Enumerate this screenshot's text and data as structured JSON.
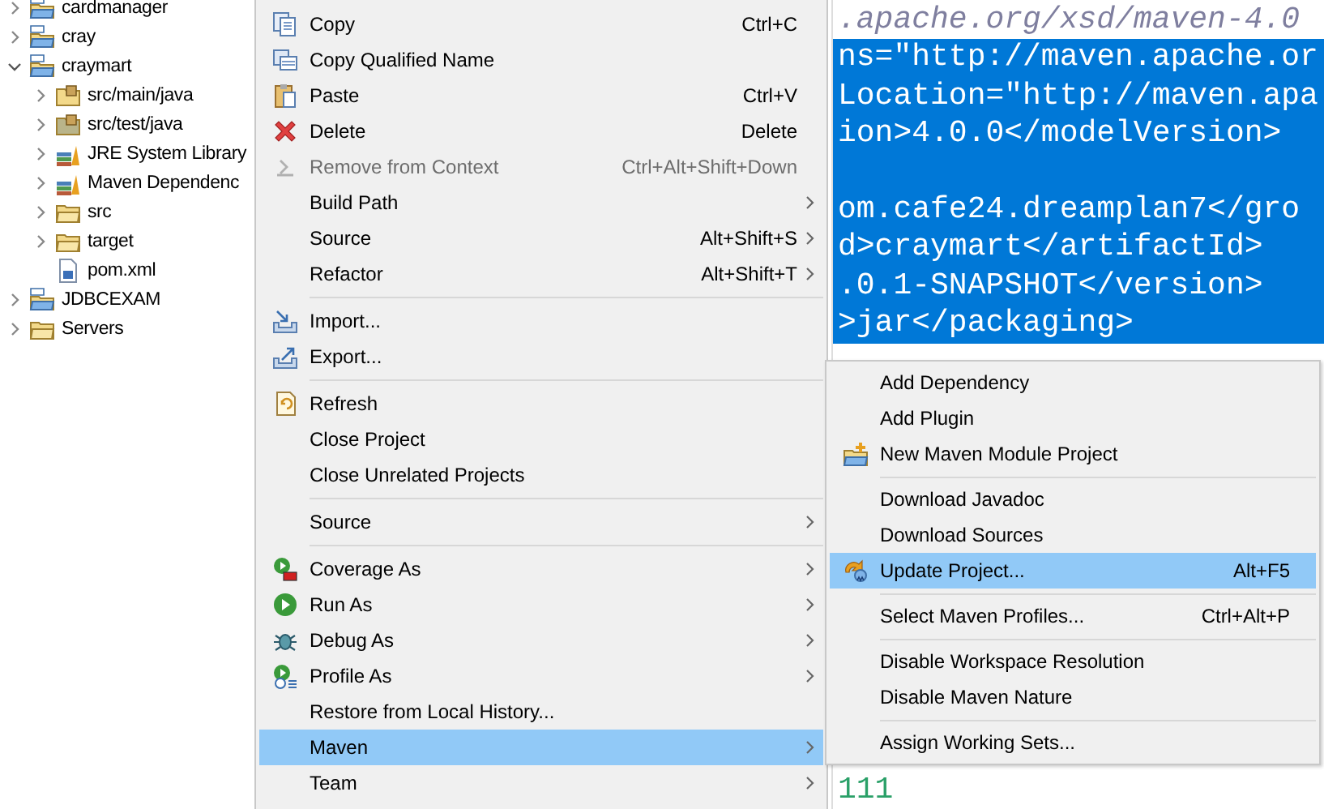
{
  "project_explorer": {
    "items": [
      {
        "label": "cardmanager",
        "kind": "project",
        "expanded": false
      },
      {
        "label": "cray",
        "kind": "project",
        "expanded": false
      },
      {
        "label": "craymart",
        "kind": "project",
        "expanded": true,
        "children": [
          {
            "label": "src/main/java",
            "kind": "source-folder",
            "expanded": false
          },
          {
            "label": "src/test/java",
            "kind": "test-folder",
            "expanded": false
          },
          {
            "label": "JRE System Library",
            "kind": "library",
            "expanded": false
          },
          {
            "label": "Maven Dependenc",
            "kind": "library",
            "expanded": false
          },
          {
            "label": "src",
            "kind": "folder",
            "expanded": false
          },
          {
            "label": "target",
            "kind": "folder",
            "expanded": false
          },
          {
            "label": "pom.xml",
            "kind": "file"
          }
        ]
      },
      {
        "label": "JDBCEXAM",
        "kind": "project",
        "expanded": false
      },
      {
        "label": "Servers",
        "kind": "folder",
        "expanded": false
      }
    ]
  },
  "editor": {
    "lines": [
      {
        "text": ".apache.org/xsd/maven-4.0",
        "kind": "comment",
        "selected": false
      },
      {
        "text": "ns=\"http://maven.apache.or",
        "kind": "code",
        "selected": true
      },
      {
        "text": "Location=\"http://maven.apa",
        "kind": "code",
        "selected": true
      },
      {
        "text": "ion>4.0.0</modelVersion>",
        "kind": "code",
        "selected": true
      },
      {
        "kind": "code",
        "selected": true
      },
      {
        "text": "om.cafe24.dreamplan7</gro",
        "kind": "code",
        "selected": true
      },
      {
        "text": "d>craymart</artifactId>",
        "kind": "code",
        "selected": true
      },
      {
        "text": ".0.1-SNAPSHOT</version>",
        "kind": "code",
        "selected": true
      },
      {
        "text": ">jar</packaging>",
        "kind": "code",
        "selected": true
      }
    ],
    "bottom_line": {
      "text": "111",
      "kind": "number",
      "selected": false
    }
  },
  "context_menu": {
    "items": [
      {
        "kind": "item",
        "label": "Copy",
        "shortcut": "Ctrl+C",
        "submenu": false,
        "disabled": false,
        "selected": false
      },
      {
        "kind": "item",
        "label": "Copy Qualified Name",
        "submenu": false,
        "disabled": false,
        "selected": false
      },
      {
        "kind": "item",
        "label": "Paste",
        "shortcut": "Ctrl+V",
        "submenu": false,
        "disabled": false,
        "selected": false
      },
      {
        "kind": "item",
        "label": "Delete",
        "shortcut": "Delete",
        "submenu": false,
        "disabled": false,
        "selected": false
      },
      {
        "kind": "item",
        "label": "Remove from Context",
        "shortcut": "Ctrl+Alt+Shift+Down",
        "submenu": false,
        "disabled": true,
        "selected": false
      },
      {
        "kind": "item",
        "label": "Build Path",
        "submenu": true,
        "disabled": false,
        "selected": false
      },
      {
        "kind": "item",
        "label": "Source",
        "shortcut": "Alt+Shift+S",
        "submenu": true,
        "disabled": false,
        "selected": false
      },
      {
        "kind": "item",
        "label": "Refactor",
        "shortcut": "Alt+Shift+T",
        "submenu": true,
        "disabled": false,
        "selected": false
      },
      {
        "kind": "separator"
      },
      {
        "kind": "item",
        "label": "Import...",
        "submenu": false,
        "disabled": false,
        "selected": false
      },
      {
        "kind": "item",
        "label": "Export...",
        "submenu": false,
        "disabled": false,
        "selected": false
      },
      {
        "kind": "separator"
      },
      {
        "kind": "item",
        "label": "Refresh",
        "submenu": false,
        "disabled": false,
        "selected": false
      },
      {
        "kind": "item",
        "label": "Close Project",
        "submenu": false,
        "disabled": false,
        "selected": false
      },
      {
        "kind": "item",
        "label": "Close Unrelated Projects",
        "submenu": false,
        "disabled": false,
        "selected": false
      },
      {
        "kind": "separator"
      },
      {
        "kind": "item",
        "label": "Source",
        "submenu": true,
        "disabled": false,
        "selected": false
      },
      {
        "kind": "separator"
      },
      {
        "kind": "item",
        "label": "Coverage As",
        "submenu": true,
        "disabled": false,
        "selected": false
      },
      {
        "kind": "item",
        "label": "Run As",
        "submenu": true,
        "disabled": false,
        "selected": false
      },
      {
        "kind": "item",
        "label": "Debug As",
        "submenu": true,
        "disabled": false,
        "selected": false
      },
      {
        "kind": "item",
        "label": "Profile As",
        "submenu": true,
        "disabled": false,
        "selected": false
      },
      {
        "kind": "item",
        "label": "Restore from Local History...",
        "submenu": false,
        "disabled": false,
        "selected": false
      },
      {
        "kind": "item",
        "label": "Maven",
        "submenu": true,
        "disabled": false,
        "selected": true
      },
      {
        "kind": "item",
        "label": "Team",
        "submenu": true,
        "disabled": false,
        "selected": false
      }
    ]
  },
  "maven_submenu": {
    "items": [
      {
        "kind": "item",
        "label": "Add Dependency",
        "submenu": false,
        "disabled": false,
        "selected": false
      },
      {
        "kind": "item",
        "label": "Add Plugin",
        "submenu": false,
        "disabled": false,
        "selected": false
      },
      {
        "kind": "item",
        "label": "New Maven Module Project",
        "submenu": false,
        "disabled": false,
        "selected": false
      },
      {
        "kind": "separator"
      },
      {
        "kind": "item",
        "label": "Download Javadoc",
        "submenu": false,
        "disabled": false,
        "selected": false
      },
      {
        "kind": "item",
        "label": "Download Sources",
        "submenu": false,
        "disabled": false,
        "selected": false
      },
      {
        "kind": "item",
        "label": "Update Project...",
        "shortcut": "Alt+F5",
        "submenu": false,
        "disabled": false,
        "selected": true
      },
      {
        "kind": "separator"
      },
      {
        "kind": "item",
        "label": "Select Maven Profiles...",
        "shortcut": "Ctrl+Alt+P",
        "submenu": false,
        "disabled": false,
        "selected": false
      },
      {
        "kind": "separator"
      },
      {
        "kind": "item",
        "label": "Disable Workspace Resolution",
        "submenu": false,
        "disabled": false,
        "selected": false
      },
      {
        "kind": "item",
        "label": "Disable Maven Nature",
        "submenu": false,
        "disabled": false,
        "selected": false
      },
      {
        "kind": "separator"
      },
      {
        "kind": "item",
        "label": "Assign Working Sets...",
        "submenu": false,
        "disabled": false,
        "selected": false
      }
    ]
  }
}
